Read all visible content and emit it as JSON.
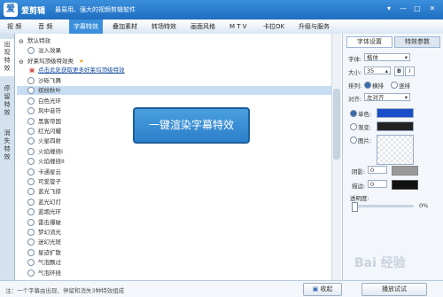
{
  "app": {
    "name": "爱剪辑",
    "slogan": "最易用、强大的视频剪辑软件",
    "logo_text": "爱"
  },
  "window_buttons": [
    "▾",
    "—",
    "□",
    "✕"
  ],
  "menu": {
    "tabs": [
      "视 频",
      "音 频",
      "字幕特效",
      "叠加素材",
      "转场特效",
      "画面风格",
      "M T V",
      "卡拉OK",
      "升级与服务"
    ],
    "active_tab": "字幕特效"
  },
  "side_tabs": [
    {
      "label": "出现特效",
      "active": true
    },
    {
      "label": "停留特效",
      "active": false
    },
    {
      "label": "消失特效",
      "active": false
    }
  ],
  "effects": {
    "group_default": "默认特效",
    "default_items": [
      "淡入效果"
    ],
    "group_recommended": "好莱坞顶级特效类",
    "promo_link": "点击此处获取更多好莱坞顶级特效",
    "items": [
      "沙砾飞舞",
      "缤纷秋叶",
      "白色光环",
      "风中音符",
      "黑客帝国",
      "红光闪耀",
      "火星四射",
      "火焰缠绕I",
      "火焰缠绕II",
      "卡通星云",
      "可爱旋子",
      "蓝光飞掠",
      "蓝光幻灯",
      "蓝烟光环",
      "雷击爆破",
      "梦幻流光",
      "迷幻光斑",
      "星迹扩散",
      "气泡飘过",
      "气泡环绕"
    ],
    "selected": "缤纷秋叶"
  },
  "callout": {
    "text": "一键渲染字幕特效"
  },
  "right_panel": {
    "tabs": [
      "字体设置",
      "特效参数"
    ],
    "active_tab": "字体设置",
    "font_label": "字体:",
    "font_value": "楷体",
    "size_label": "大小:",
    "size_value": "35",
    "bold_label": "B",
    "italic_label": "I",
    "arrange_label": "排列:",
    "arrange_options": [
      "横排",
      "竖排"
    ],
    "align_label": "对齐:",
    "align_value": "左对齐",
    "single_color_label": "单色:",
    "gradient_label": "渐变:",
    "picture_label": "图片:",
    "shadow_label": "阴影:",
    "shadow_value": "0",
    "stroke_label": "描边:",
    "stroke_value": "0",
    "opacity_label": "透明度:",
    "opacity_value": "0%",
    "opacity_fraction": 0.0,
    "single_color": "#1a4ec8",
    "gradient_color": "#222222"
  },
  "bottom": {
    "hint": "注：一个字幕由出现、停留和消失3种特效组成",
    "collapse_label": "收起",
    "preview_label": "播放试试"
  },
  "watermark": "Bai 经验"
}
